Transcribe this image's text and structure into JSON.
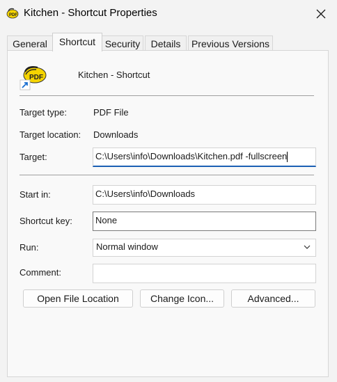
{
  "window": {
    "title": "Kitchen - Shortcut Properties"
  },
  "tabs": [
    {
      "label": "General",
      "active": false
    },
    {
      "label": "Shortcut",
      "active": true
    },
    {
      "label": "Security",
      "active": false
    },
    {
      "label": "Details",
      "active": false
    },
    {
      "label": "Previous Versions",
      "active": false
    }
  ],
  "header": {
    "name": "Kitchen - Shortcut",
    "icon_text": "PDF"
  },
  "info": {
    "target_type_label": "Target type:",
    "target_type_value": "PDF File",
    "target_location_label": "Target location:",
    "target_location_value": "Downloads",
    "target_label": "Target:",
    "target_value": "C:\\Users\\info\\Downloads\\Kitchen.pdf -fullscreen"
  },
  "fields": {
    "start_in_label": "Start in:",
    "start_in_value": "C:\\Users\\info\\Downloads",
    "shortcut_key_label": "Shortcut key:",
    "shortcut_key_value": "None",
    "run_label": "Run:",
    "run_value": "Normal window",
    "comment_label": "Comment:",
    "comment_value": ""
  },
  "buttons": {
    "open_file_location": "Open File Location",
    "change_icon": "Change Icon...",
    "advanced": "Advanced..."
  },
  "colors": {
    "accent": "#1a5fb4",
    "icon_yellow": "#f5d400"
  }
}
